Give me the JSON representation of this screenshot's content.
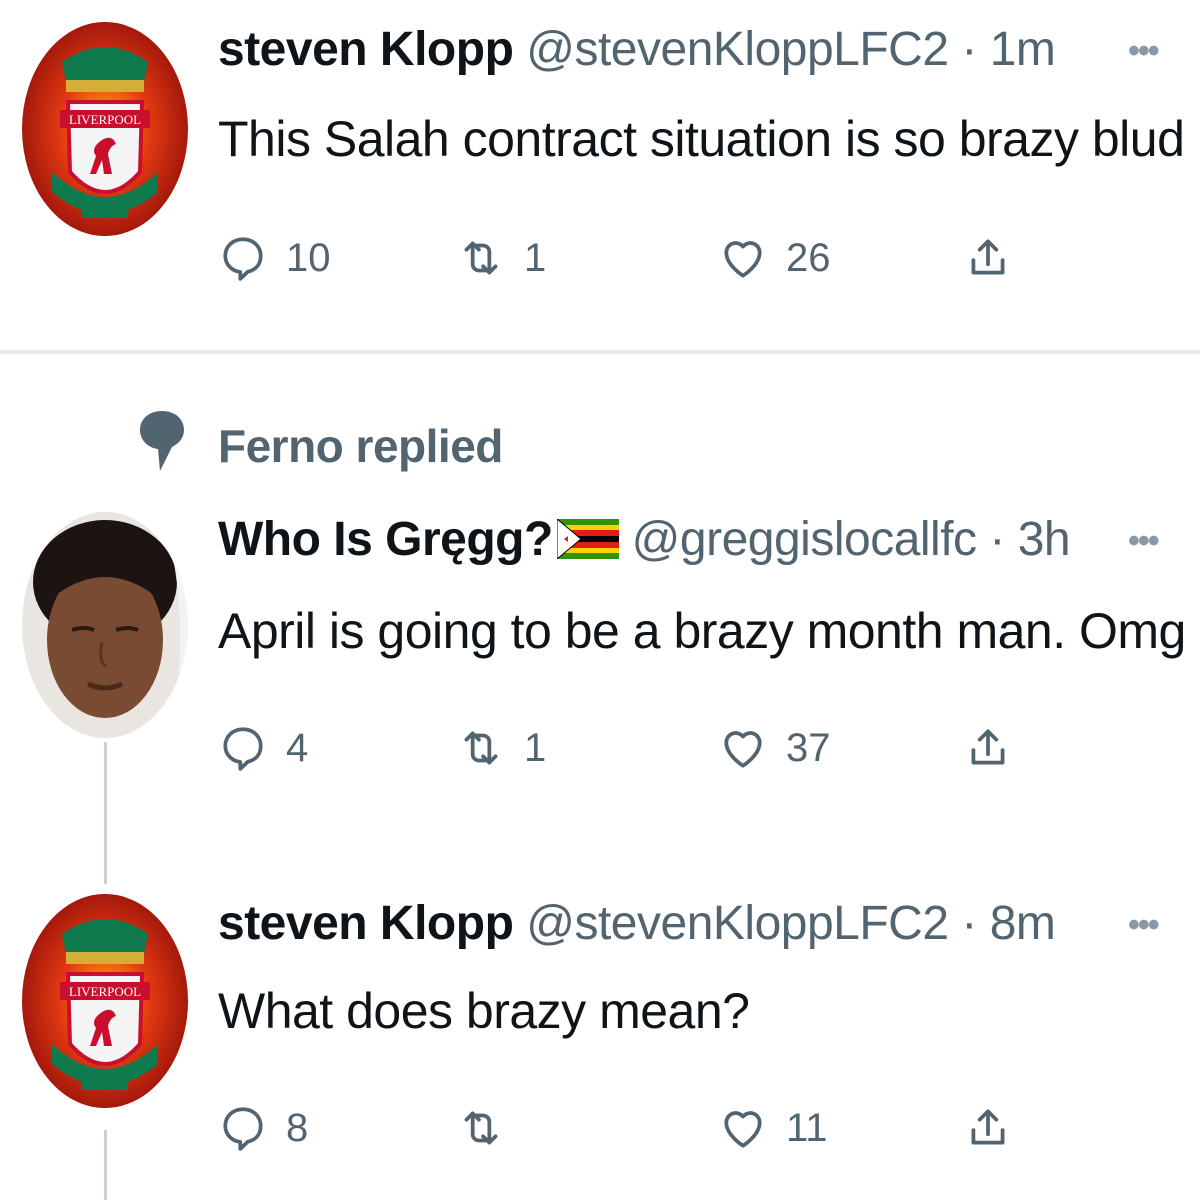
{
  "tweets": [
    {
      "name": "steven Klopp",
      "handle": "@stevenKloppLFC2",
      "dot": "·",
      "time": "1m",
      "more": "•••",
      "text": "This Salah contract situation is so brazy blud",
      "replies": "10",
      "retweets": "1",
      "likes": "26",
      "avatar": "liverpool-crest"
    },
    {
      "name": "Who Is Gręgg?",
      "flag": "zimbabwe-flag",
      "handle": "@greggislocallfc",
      "dot": "·",
      "time": "3h",
      "more": "•••",
      "text": "April is going to be a brazy month man. Omg",
      "replies": "4",
      "retweets": "1",
      "likes": "37",
      "avatar": "user-photo"
    },
    {
      "name": "steven Klopp",
      "handle": "@stevenKloppLFC2",
      "dot": "·",
      "time": "8m",
      "more": "•••",
      "text": "What does brazy mean?",
      "replies": "8",
      "retweets": "",
      "likes": "11",
      "avatar": "liverpool-crest"
    }
  ],
  "replied_context": {
    "label": "Ferno replied",
    "icon": "speech-bubble-icon"
  },
  "colors": {
    "primary_text": "#0f1419",
    "secondary_text": "#536471",
    "divider": "#e6ecf0",
    "crest_red": "#c8102e",
    "crest_green": "#00a398"
  }
}
